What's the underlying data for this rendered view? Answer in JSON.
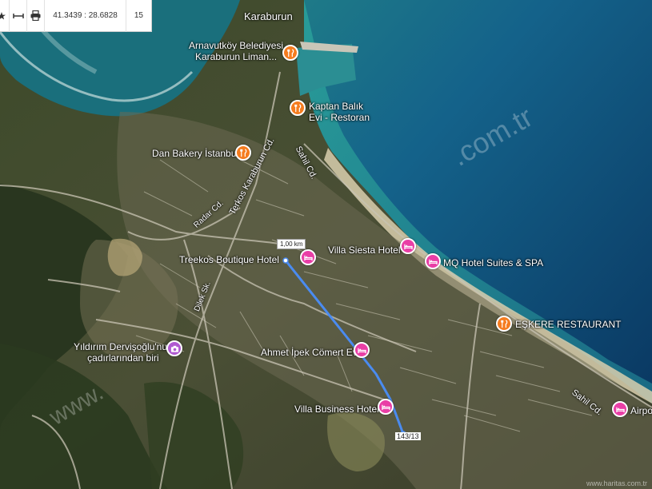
{
  "toolbar": {
    "coords": "41.3439 : 28.6828",
    "zoom": "15"
  },
  "places": {
    "karaburun": "Karaburun",
    "arnavutkoy_1": "Arnavutköy Belediyesi",
    "arnavutkoy_2": "Karaburun Liman...",
    "kaptan_1": "Kaptan Balık",
    "kaptan_2": "Evi - Restoran",
    "dan_bakery": "Dan Bakery İstanbul",
    "treekos": "Treekos Boutique Hotel",
    "villa_siesta": "Villa Siesta Hotel",
    "mq_hotel": "MQ Hotel Suites & SPA",
    "eskere": "EŞKERE RESTAURANT",
    "ahmet": "Ahmet İpek Cömert Ev",
    "villa_business": "Villa Business Hotel",
    "yildirim_1": "Yıldırım Dervişoğlu'nun",
    "yildirim_2": "çadırlarından biri",
    "airport": "Airpo"
  },
  "streets": {
    "terkos": "Terkos Karaburun Cd.",
    "sahil_top": "Sahil Cd.",
    "sahil_bottom": "Sahil Cd.",
    "radar": "Radar Cd.",
    "dilek": "Dilek Sk."
  },
  "measure": {
    "distance": "1,00 km",
    "end_label": "143/13"
  },
  "watermarks": {
    "top": ".com.tr",
    "bottom": "www.",
    "brand": "www.haritas.com.tr"
  },
  "colors": {
    "restaurant_pin": "#f57c1f",
    "hotel_pin": "#e93ea6",
    "attraction_pin": "#b05ad1",
    "route": "#4a8bf0",
    "deep_sea": "#0b3c66",
    "shallow_sea": "#1c7f86"
  },
  "icons": {
    "restaurant": "fork-knife-icon",
    "hotel": "bed-icon",
    "attraction": "camera-icon"
  }
}
